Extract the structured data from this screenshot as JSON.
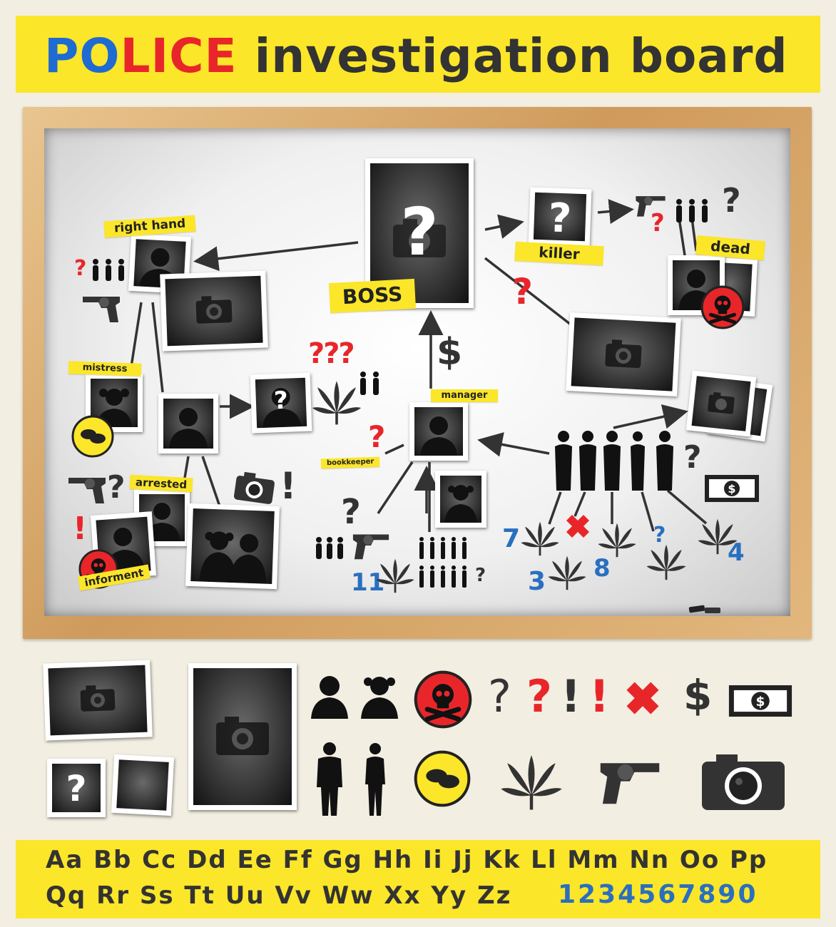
{
  "title": {
    "segments": [
      {
        "text": "PO",
        "color": "#1f6bd1"
      },
      {
        "text": "LICE",
        "color": "#e8262a"
      },
      {
        "text": " investigation board",
        "color": "#333333"
      }
    ]
  },
  "labels": {
    "boss": "BOSS",
    "killer": "killer",
    "dead": "dead",
    "right_hand": "right hand",
    "mistress": "mistress",
    "manager": "manager",
    "bookkeeper": "bookkeeper",
    "arrested": "arrested",
    "informent": "informent"
  },
  "numbers": {
    "n7": "7",
    "n3": "3",
    "n8": "8",
    "n4": "4",
    "n11": "11"
  },
  "symbols": {
    "question": "?",
    "triple_question": "???",
    "exclamation": "!",
    "dollar": "$"
  },
  "alphabet": {
    "row1": "Aa Bb Cc Dd Ee Ff Gg Hh Ii Jj Kk Ll Mm Nn Oo Pp",
    "row2": "Qq Rr Ss Tt Uu Vv Ww Xx Yy Zz",
    "digits": "1234567890"
  },
  "colors": {
    "yellow": "#fbe629",
    "red": "#e8262a",
    "blue": "#2a6fbf",
    "dark": "#333333"
  },
  "icons": [
    "camera-icon",
    "person-icon",
    "girl-icon",
    "skull-icon",
    "speech-icon",
    "cannabis-leaf-icon",
    "revolver-icon",
    "cross-icon",
    "banknote-icon",
    "chalk-icon"
  ]
}
